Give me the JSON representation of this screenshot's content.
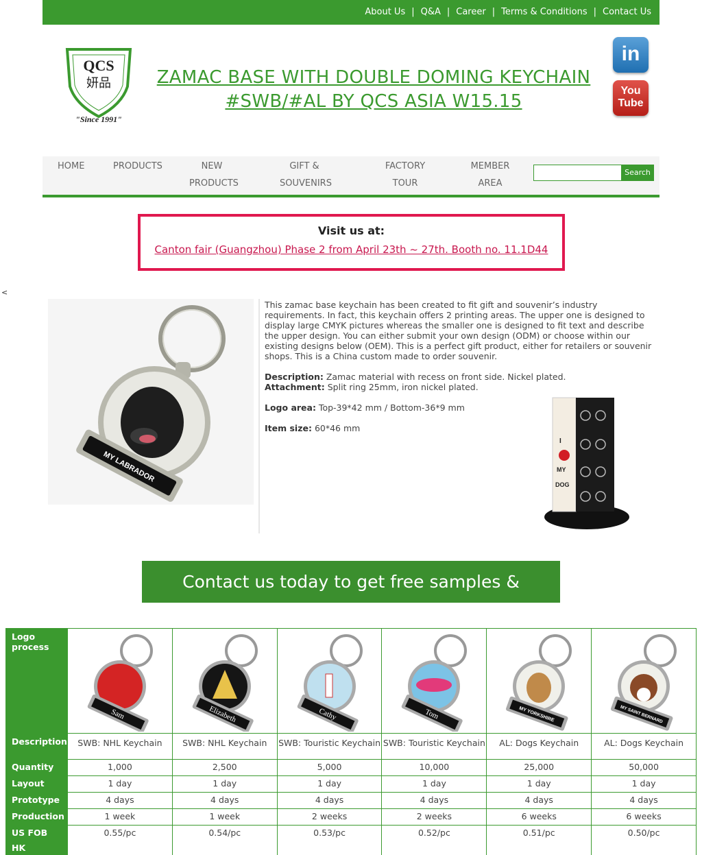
{
  "toplinks": [
    "About Us",
    "Q&A",
    "Career",
    "Terms & Conditions",
    "Contact Us"
  ],
  "logo": {
    "main": "QCS",
    "chinese": "妍品",
    "since": "\"Since 1991\""
  },
  "title": {
    "line1": "ZAMAC BASE WITH DOUBLE DOMING KEYCHAIN",
    "line2": "#SWB/#AL BY QCS ASIA W15.15"
  },
  "social": {
    "linkedin": "in",
    "youtube1": "You",
    "youtube2": "Tube"
  },
  "nav": {
    "home": "HOME",
    "products": "PRODUCTS",
    "new1": "NEW",
    "new2": "PRODUCTS",
    "gift1": "GIFT &",
    "gift2": "SOUVENIRS",
    "factory1": "FACTORY",
    "factory2": "TOUR",
    "member1": "MEMBER",
    "member2": "AREA",
    "search_button": "Search"
  },
  "visit": {
    "title": "Visit us at:",
    "line": "Canton fair (Guangzhou) Phase 2 from April 23th ~ 27th. Booth no. 11.1D44"
  },
  "stray": "<",
  "product": {
    "intro": "This zamac base keychain has been created to fit gift and souvenir’s industry requirements. In fact, this keychain offers 2 printing areas. The upper one is designed to display large CMYK pictures whereas the smaller one is designed to fit text and describe the upper design. You can either submit your own design (ODM) or choose within our existing designs below (OEM). This is a perfect gift product, either for retailers or souvenir shops. This is a China custom made to order souvenir.",
    "desc_label": "Description:",
    "desc_value": " Zamac material with recess on front side. Nickel plated.",
    "attach_label": "Attachment:",
    "attach_value": " Split ring 25mm, iron nickel plated.",
    "logo_label": "Logo area:",
    "logo_value": " Top-39*42 mm / Bottom-36*9 mm",
    "size_label": "Item size:",
    "size_value": " 60*46 mm",
    "img_text": "MY LABRADOR",
    "display_text1": "I",
    "display_text2": "MY",
    "display_text3": "DOG"
  },
  "cta": "Contact us today to get free samples & prototype.",
  "table": {
    "row_labels": [
      "Logo process",
      "Description",
      "Quantity",
      "Layout",
      "Prototype",
      "Production",
      "US FOB HK"
    ],
    "cols": [
      {
        "img_label": "Sam",
        "desc": "SWB: NHL Keychain",
        "qty": "1,000",
        "layout": "1 day",
        "proto": "4 days",
        "prod": "1 week",
        "price": "0.55/pc"
      },
      {
        "img_label": "Elizabeth",
        "desc": "SWB: NHL Keychain",
        "qty": "2,500",
        "layout": "1 day",
        "proto": "4 days",
        "prod": "1 week",
        "price": "0.54/pc"
      },
      {
        "img_label": "Cathy",
        "desc": "SWB: Touristic Keychain",
        "qty": "5,000",
        "layout": "1 day",
        "proto": "4 days",
        "prod": "2 weeks",
        "price": "0.53/pc"
      },
      {
        "img_label": "Tom",
        "desc": "SWB: Touristic Keychain",
        "qty": "10,000",
        "layout": "1 day",
        "proto": "4 days",
        "prod": "2 weeks",
        "price": "0.52/pc"
      },
      {
        "img_label": "MY YORKSHIRE",
        "desc": "AL: Dogs Keychain",
        "qty": "25,000",
        "layout": "1 day",
        "proto": "4 days",
        "prod": "6 weeks",
        "price": "0.51/pc"
      },
      {
        "img_label": "MY SAINT BERNARD",
        "desc": "AL: Dogs Keychain",
        "qty": "50,000",
        "layout": "1 day",
        "proto": "4 days",
        "prod": "6 weeks",
        "price": "0.50/pc"
      }
    ]
  },
  "colors": {
    "brand_green": "#3b9a2f",
    "visit_border": "#e0184f"
  }
}
